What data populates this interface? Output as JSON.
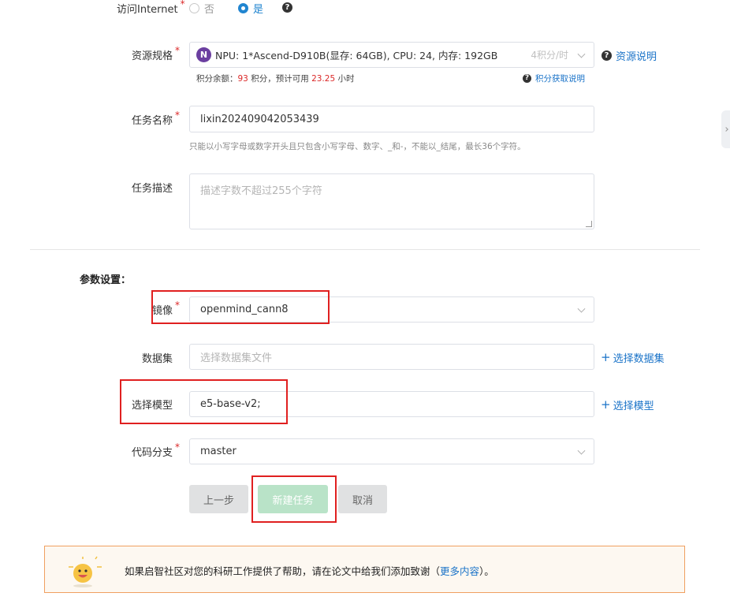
{
  "internet": {
    "label": "访问Internet",
    "required_mark": "*",
    "option_no": "否",
    "option_yes": "是",
    "selected": "是"
  },
  "resource": {
    "label": "资源规格",
    "required_mark": "*",
    "badge_letter": "N",
    "value": "NPU: 1*Ascend-D910B(显存: 64GB), CPU: 24, 内存: 192GB",
    "price": "4积分/时",
    "doc_link": "资源说明",
    "balance_prefix": "积分余额：",
    "balance_value": "93",
    "balance_mid": " 积分，预计可用 ",
    "hours_value": "23.25",
    "balance_suffix": " 小时",
    "earn_link": "积分获取说明"
  },
  "task_name": {
    "label": "任务名称",
    "required_mark": "*",
    "value": "lixin202409042053439",
    "hint": "只能以小写字母或数字开头且只包含小写字母、数字、_和-，不能以_结尾，最长36个字符。"
  },
  "task_desc": {
    "label": "任务描述",
    "placeholder": "描述字数不超过255个字符"
  },
  "params": {
    "section_title": "参数设置：",
    "image": {
      "label": "镜像",
      "required_mark": "*",
      "value": "openmind_cann8"
    },
    "dataset": {
      "label": "数据集",
      "placeholder": "选择数据集文件",
      "add_link": "选择数据集"
    },
    "model": {
      "label": "选择模型",
      "value": "e5-base-v2;",
      "add_link": "选择模型"
    },
    "branch": {
      "label": "代码分支",
      "required_mark": "*",
      "value": "master"
    }
  },
  "buttons": {
    "prev": "上一步",
    "create": "新建任务",
    "cancel": "取消"
  },
  "banner": {
    "text": "如果启智社区对您的科研工作提供了帮助，请在论文中给我们添加致谢（",
    "link": "更多内容",
    "suffix": "）。"
  },
  "colors": {
    "accent": "#2185d0",
    "link": "#1a73c8",
    "required": "#db2828",
    "highlight_box": "#e02020",
    "create_button": "#b9e3c8",
    "banner_border": "#f0a060",
    "badge": "#6b3fa0"
  }
}
